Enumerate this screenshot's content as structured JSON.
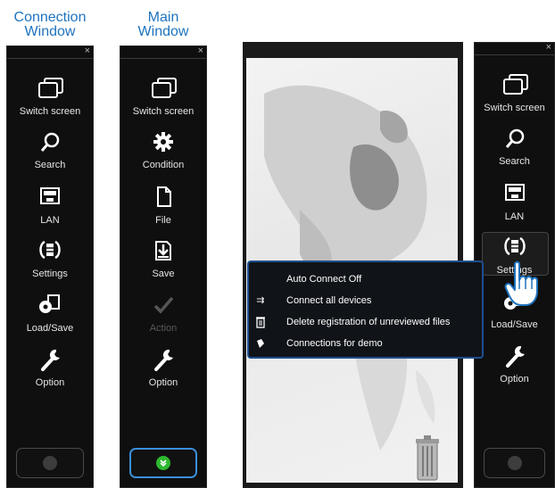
{
  "captions": {
    "connection_window": [
      "Connection",
      "Window"
    ],
    "main_window": [
      "Main",
      "Window"
    ]
  },
  "close_glyph": "×",
  "connection_panel": {
    "buttons": [
      {
        "label": "Switch screen",
        "icon": "switch-screen-icon"
      },
      {
        "label": "Search",
        "icon": "search-icon"
      },
      {
        "label": "LAN",
        "icon": "lan-icon"
      },
      {
        "label": "Settings",
        "icon": "settings-icon"
      },
      {
        "label": "Load/Save",
        "icon": "load-save-icon"
      },
      {
        "label": "Option",
        "icon": "wrench-icon"
      }
    ]
  },
  "main_panel": {
    "buttons": [
      {
        "label": "Switch screen",
        "icon": "switch-screen-icon"
      },
      {
        "label": "Condition",
        "icon": "gear-icon"
      },
      {
        "label": "File",
        "icon": "file-icon"
      },
      {
        "label": "Save",
        "icon": "save-icon"
      },
      {
        "label": "Action",
        "icon": "check-icon",
        "disabled": true
      },
      {
        "label": "Option",
        "icon": "wrench-icon"
      }
    ]
  },
  "right_panel": {
    "buttons": [
      {
        "label": "Switch screen",
        "icon": "switch-screen-icon"
      },
      {
        "label": "Search",
        "icon": "search-icon"
      },
      {
        "label": "LAN",
        "icon": "lan-icon"
      },
      {
        "label": "Settings",
        "icon": "settings-icon",
        "highlighted": true
      },
      {
        "label": "Load/Save",
        "icon": "load-save-icon"
      },
      {
        "label": "Option",
        "icon": "wrench-icon"
      }
    ]
  },
  "settings_menu": {
    "items": [
      {
        "label": "Auto Connect Off",
        "icon": ""
      },
      {
        "label": "Connect all devices",
        "icon": "connect-all-icon"
      },
      {
        "label": "Delete registration of unreviewed files",
        "icon": "trash-icon"
      },
      {
        "label": "Connections for demo",
        "icon": "tag-icon"
      }
    ]
  },
  "colors": {
    "caption": "#1e73be",
    "panel_bg": "#0f0f0f",
    "menu_border": "#1d4f8f",
    "active_dot": "#2eb82e",
    "active_border": "#3a8fd8"
  }
}
